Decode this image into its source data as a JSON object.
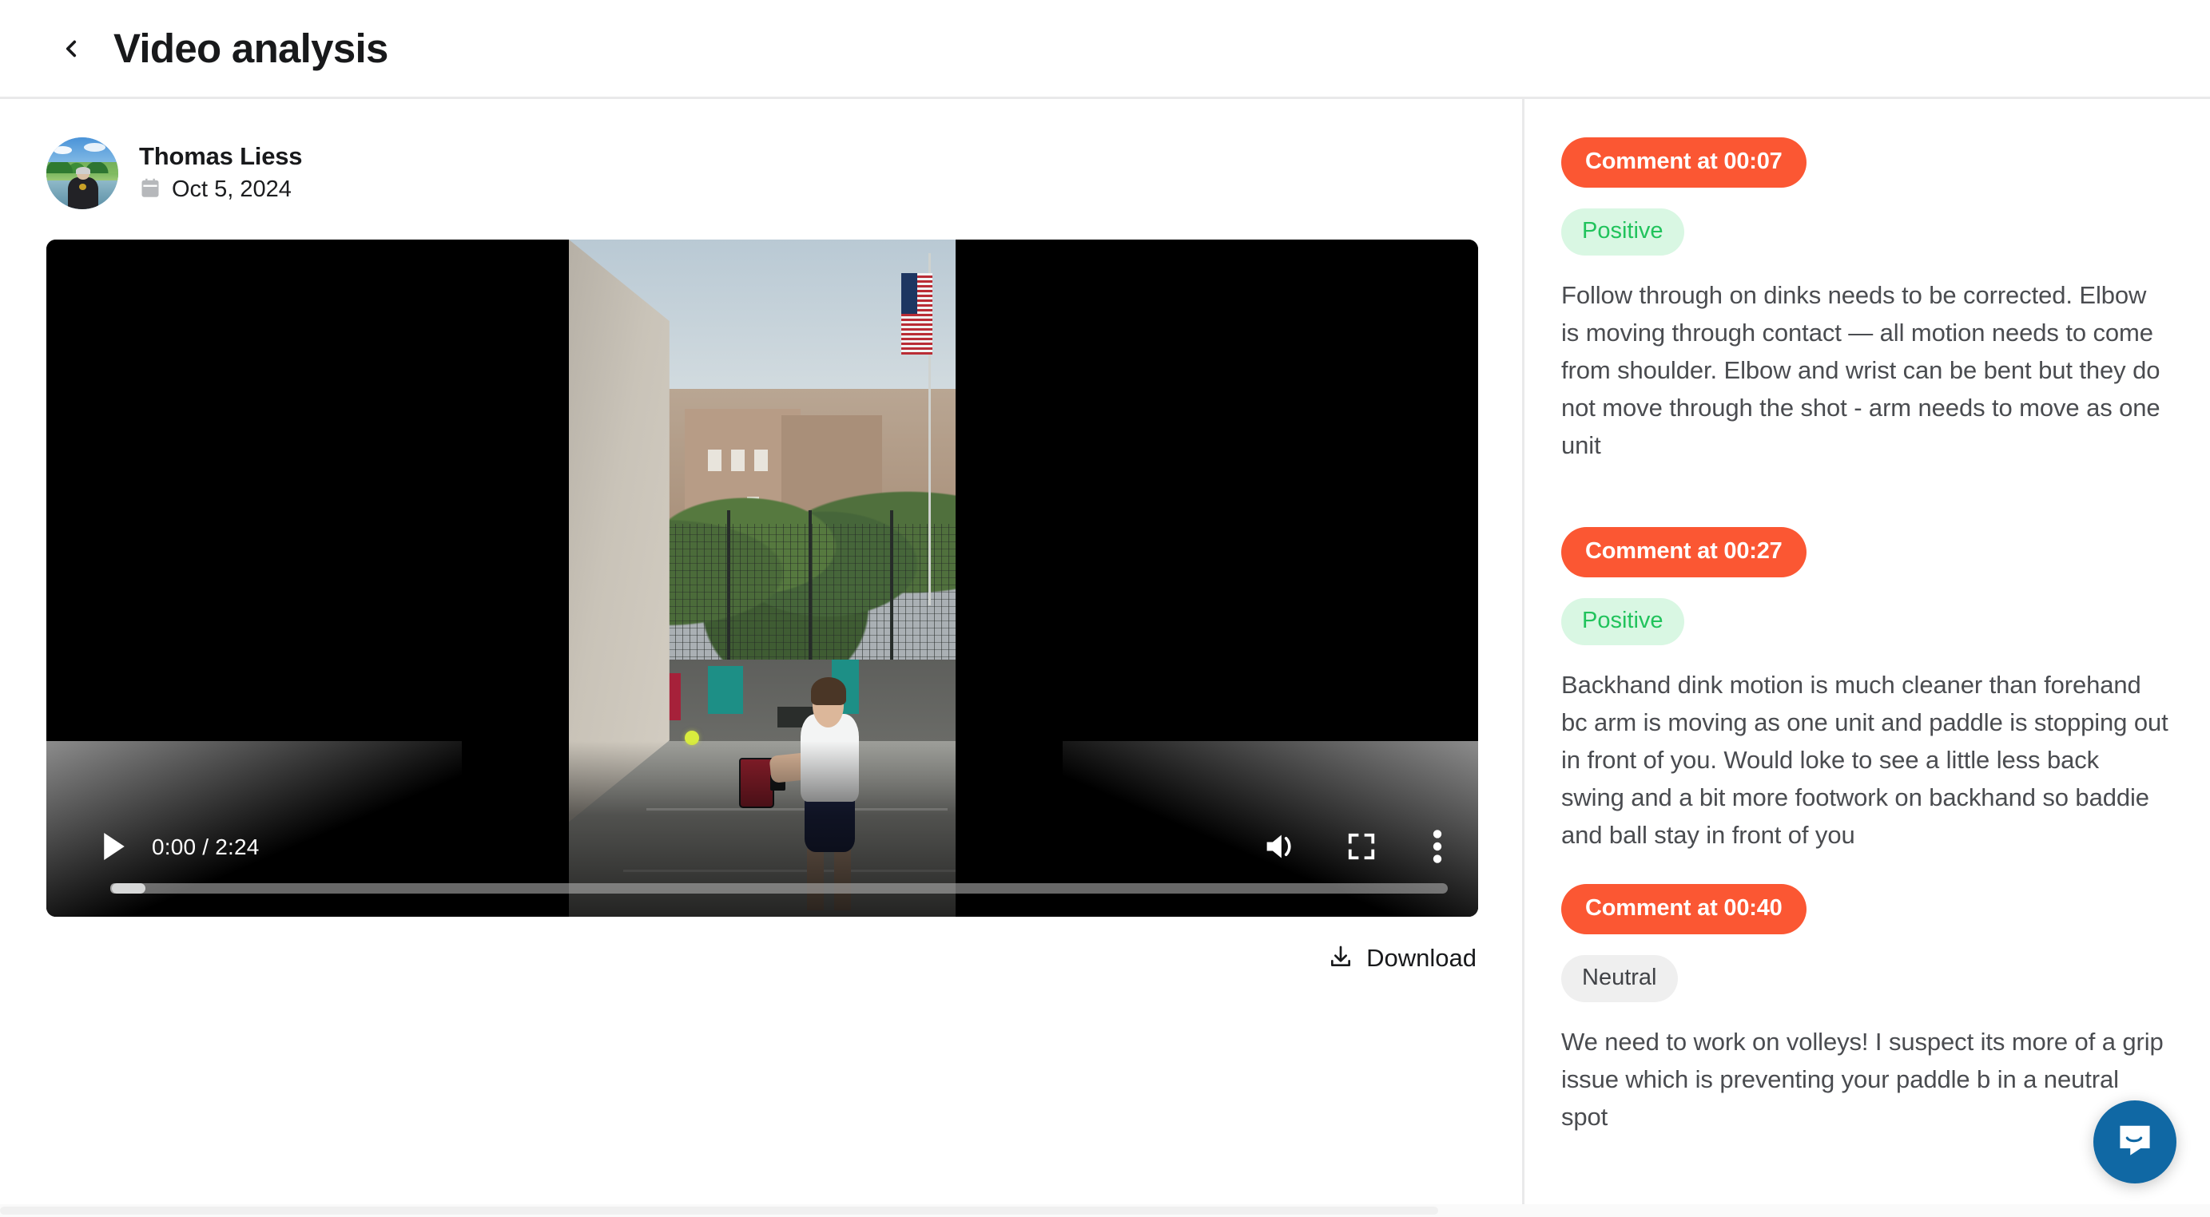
{
  "header": {
    "back_icon": "chevron-left-icon",
    "title": "Video analysis"
  },
  "uploader": {
    "name": "Thomas Liess",
    "date": "Oct 5, 2024",
    "calendar_icon": "calendar-icon",
    "avatar_alt": "profile photo of a person standing in a lake with trees and sky"
  },
  "video": {
    "current_time": "0:00",
    "duration": "2:24",
    "time_display": "0:00 / 2:24",
    "progress_percent": 0,
    "play_icon": "play-icon",
    "volume_icon": "volume-icon",
    "fullscreen_icon": "fullscreen-icon",
    "more_options_icon": "more-vertical-icon",
    "scene_description": "pickleball player in white shirt and navy shorts hitting a yellow ball against a handball wall on an outdoor city court"
  },
  "download": {
    "label": "Download",
    "icon": "download-icon"
  },
  "comments": [
    {
      "time_label": "Comment at 00:07",
      "sentiment": "Positive",
      "sentiment_type": "positive",
      "text": "Follow through on dinks needs to be corrected. Elbow is moving through contact — all motion needs to come from shoulder. Elbow and wrist can be bent but they do not move through the shot - arm needs to move as one unit"
    },
    {
      "time_label": "Comment at 00:27",
      "sentiment": "Positive",
      "sentiment_type": "positive",
      "text": "Backhand dink motion is much cleaner than forehand bc arm is moving as one unit and paddle is stopping out in front of you. Would loke to see a little less back swing and a bit more footwork on backhand so baddie and ball stay in front of you"
    },
    {
      "time_label": "Comment at 00:40",
      "sentiment": "Neutral",
      "sentiment_type": "neutral",
      "text": "We need to work on volleys! I suspect its more of a grip issue which is preventing your paddle b in a neutral spot"
    }
  ],
  "support_widget": {
    "icon": "intercom-chat-icon",
    "color": "#1068a4"
  },
  "colors": {
    "accent_orange": "#fb5733",
    "positive_green": "#21c35c",
    "positive_bg": "#d9f7e3",
    "neutral_text": "#414347",
    "neutral_bg": "#efefef",
    "text_primary": "#18191b",
    "text_body": "#4a4c50",
    "divider": "#e9e9ea"
  }
}
